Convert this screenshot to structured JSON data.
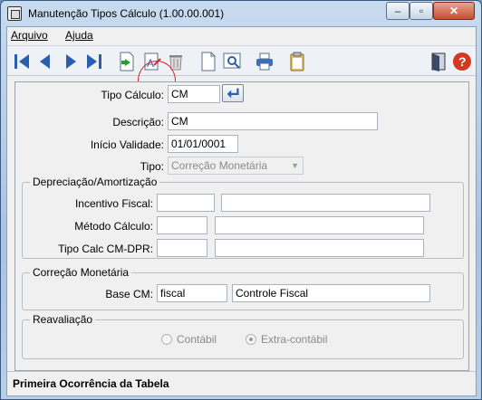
{
  "window": {
    "title": "Manutenção Tipos Cálculo (1.00.00.001)"
  },
  "menu": {
    "items": [
      {
        "label": "Arquivo"
      },
      {
        "label": "Ajuda"
      }
    ]
  },
  "toolbar": {
    "icons": [
      "first-record-icon",
      "previous-record-icon",
      "next-record-icon",
      "last-record-icon",
      "add-record-icon",
      "edit-record-icon",
      "delete-record-icon",
      "new-document-icon",
      "print-preview-icon",
      "print-icon",
      "clipboard-icon",
      "exit-door-icon",
      "help-icon"
    ]
  },
  "form": {
    "tipo_calculo": {
      "label": "Tipo Cálculo:",
      "value": "CM"
    },
    "descricao": {
      "label": "Descrição:",
      "value": "CM"
    },
    "inicio_validade": {
      "label": "Início Validade:",
      "value": "01/01/0001"
    },
    "tipo": {
      "label": "Tipo:",
      "value": "Correção Monetária"
    },
    "depreciacao": {
      "title": "Depreciação/Amortização",
      "incentivo_fiscal": {
        "label": "Incentivo Fiscal:",
        "code": "",
        "desc": ""
      },
      "metodo_calculo": {
        "label": "Método Cálculo:",
        "code": "",
        "desc": ""
      },
      "tipo_calc_cm_dpr": {
        "label": "Tipo Calc CM-DPR:",
        "code": "",
        "desc": ""
      }
    },
    "correcao": {
      "title": "Correção Monetária",
      "base_cm": {
        "label": "Base CM:",
        "code": "fiscal",
        "desc": "Controle Fiscal"
      }
    },
    "reavaliacao": {
      "title": "Reavaliação",
      "options": [
        {
          "label": "Contábil",
          "selected": false
        },
        {
          "label": "Extra-contábil",
          "selected": true
        }
      ]
    }
  },
  "status": {
    "text": "Primeira Ocorrência da Tabela"
  },
  "colors": {
    "toolbar_icon_blue": "#2a5fb0",
    "help_red": "#d2391e",
    "highlight_circle": "#e02030"
  }
}
